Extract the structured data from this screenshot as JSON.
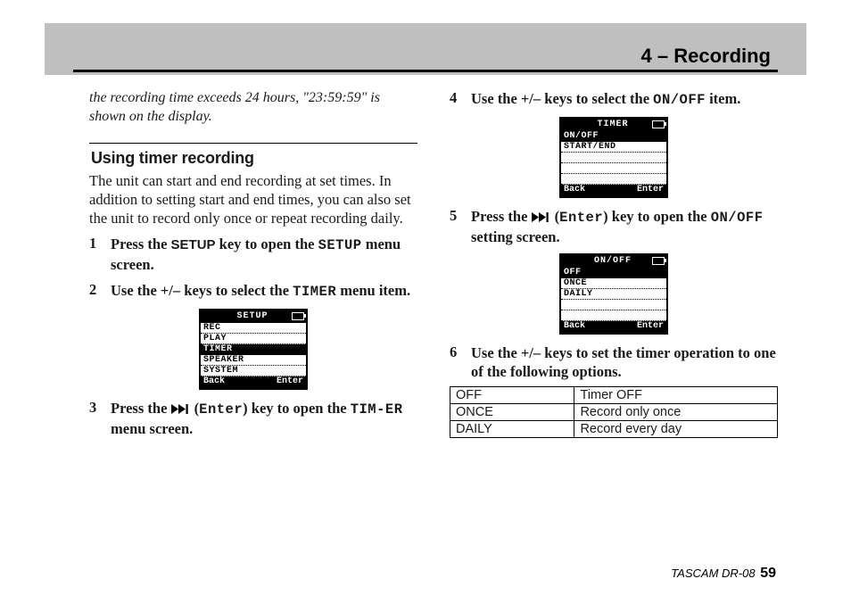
{
  "header": {
    "title": "4 – Recording"
  },
  "footer": {
    "product": "TASCAM  DR-08",
    "page": "59"
  },
  "left": {
    "carryover": "the recording time exceeds 24 hours, \"23:59:59\" is shown on the display.",
    "section_title": "Using timer recording",
    "intro": "The unit can start and end recording at set times. In addition to setting start and end times, you can also set the unit to record only once or repeat recording daily.",
    "step1": {
      "num": "1",
      "t1": "Press the ",
      "setup_key": "SETUP",
      "t2": " key to open the ",
      "setup_lcd": "SETUP",
      "t3": " menu screen."
    },
    "step2": {
      "num": "2",
      "t1": "Use the +/– keys to select the ",
      "timer_lcd": "TIMER",
      "t2": " menu item."
    },
    "step3": {
      "num": "3",
      "t1": "Press the ",
      "enter_lcd": "Enter",
      "t2": ") key to open the ",
      "timer_lcd": "TIM-ER",
      "t3": " menu screen."
    },
    "screen_setup": {
      "title": "SETUP",
      "rows": [
        "REC",
        "PLAY",
        "TIMER",
        "SPEAKER",
        "SYSTEM"
      ],
      "selected_index": 2,
      "foot_left": "Back",
      "foot_right": "Enter"
    }
  },
  "right": {
    "step4": {
      "num": "4",
      "t1": "Use the +/– keys to select the ",
      "onoff_lcd": "ON/OFF",
      "t2": " item."
    },
    "step5": {
      "num": "5",
      "t1": "Press the ",
      "enter_lcd": "Enter",
      "t2": ") key to open the ",
      "onoff_lcd": "ON/OFF",
      "t3": " setting screen."
    },
    "step6": {
      "num": "6",
      "text": "Use the +/– keys to set the timer operation to one of the following options."
    },
    "screen_timer": {
      "title": "TIMER",
      "rows": [
        "ON/OFF",
        "START/END",
        "",
        "",
        ""
      ],
      "selected_index": 0,
      "foot_left": "Back",
      "foot_right": "Enter"
    },
    "screen_onoff": {
      "title": "ON/OFF",
      "rows": [
        "OFF",
        " ONCE",
        " DAILY",
        "",
        ""
      ],
      "selected_index": 0,
      "foot_left": "Back",
      "foot_right": "Enter"
    },
    "table": {
      "rows": [
        {
          "opt": "OFF",
          "desc": "Timer OFF"
        },
        {
          "opt": "ONCE",
          "desc": "Record only once"
        },
        {
          "opt": "DAILY",
          "desc": "Record every day"
        }
      ]
    }
  }
}
